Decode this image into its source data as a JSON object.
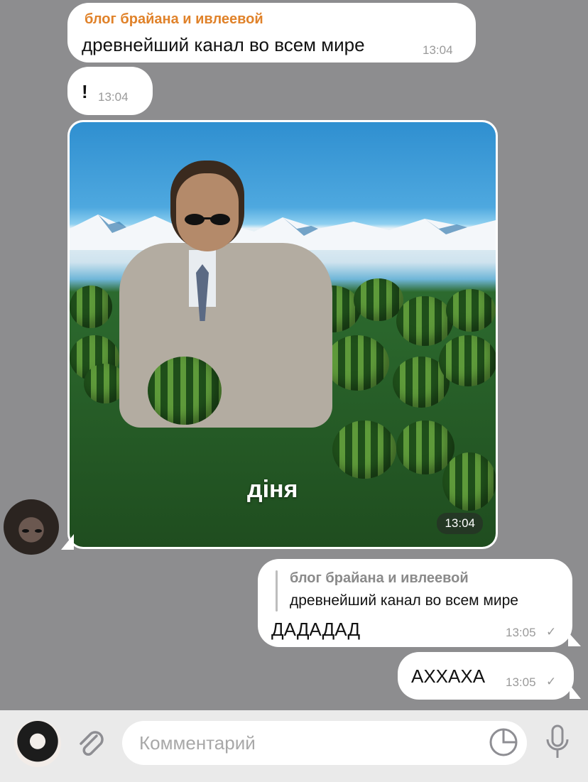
{
  "messages": [
    {
      "sender": "блог брайана и ивлеевой",
      "text": "древнейший канал во всем мире",
      "time": "13:04"
    },
    {
      "text": "!",
      "time": "13:04"
    },
    {
      "image_caption": "діня",
      "time": "13:04"
    },
    {
      "reply_to": {
        "sender": "блог брайана и ивлеевой",
        "text": "древнейший канал во всем мире"
      },
      "text": "ДАДАДАД",
      "time": "13:05",
      "status": "✓"
    },
    {
      "text": "АХХАХА",
      "time": "13:05",
      "status": "✓"
    }
  ],
  "input": {
    "placeholder": "Комментарий"
  },
  "icons": {
    "attach": "paperclip-icon",
    "sticker": "sticker-icon",
    "mic": "microphone-icon"
  },
  "colors": {
    "background": "#8d8d8f",
    "bubble": "#ffffff",
    "sender": "#e0822a"
  }
}
